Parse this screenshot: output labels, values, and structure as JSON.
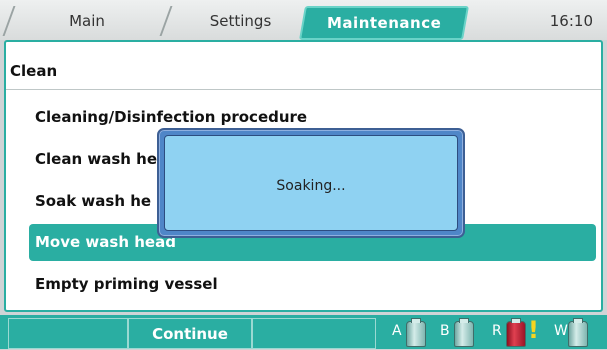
{
  "tabs": [
    {
      "label": "Main"
    },
    {
      "label": "Settings"
    },
    {
      "label": "Maintenance"
    }
  ],
  "clock": "16:10",
  "panel": {
    "title": "Clean",
    "items": [
      {
        "label": "Cleaning/Disinfection procedure"
      },
      {
        "label": "Clean wash he"
      },
      {
        "label": "Soak wash he"
      },
      {
        "label": "Move wash head"
      },
      {
        "label": "Empty priming vessel"
      }
    ]
  },
  "modal": {
    "message": "Soaking..."
  },
  "softkeys": [
    {
      "label": ""
    },
    {
      "label": "Continue"
    },
    {
      "label": ""
    }
  ],
  "bottles": [
    {
      "label": "A"
    },
    {
      "label": "B"
    },
    {
      "label": "R",
      "warning": "!"
    },
    {
      "label": "W"
    }
  ],
  "colors": {
    "accent": "#2aaea2",
    "modal_fill": "#8fd2f2",
    "modal_border": "#4f86c8",
    "warning": "#f5d520",
    "bottle_red": "#e04050"
  }
}
